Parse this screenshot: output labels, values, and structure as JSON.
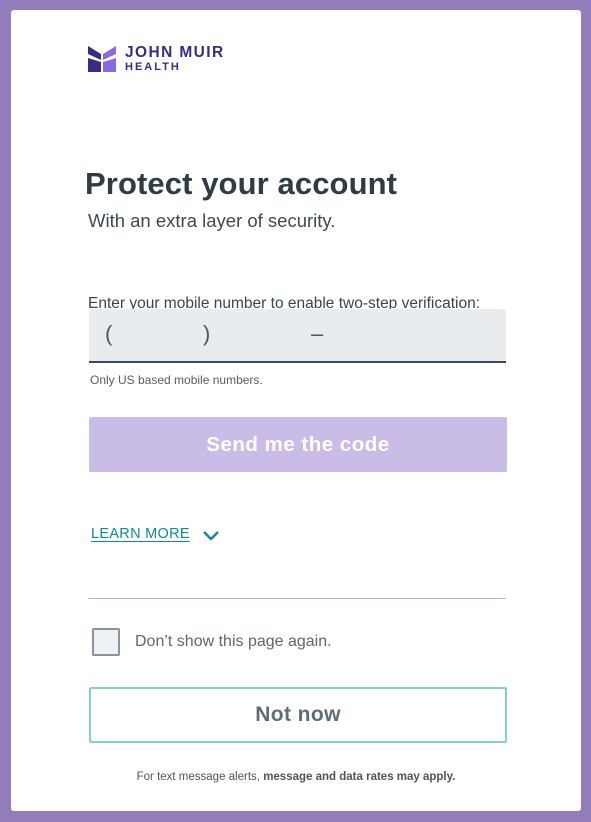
{
  "brand": {
    "name_line1": "JOHN MUIR",
    "name_line2": "HEALTH",
    "logo_color": "#7b5bd0",
    "logo_dark": "#3b2a84"
  },
  "heading": {
    "title": "Protect your account",
    "subtitle": "With an extra layer of security."
  },
  "phone": {
    "label": "Enter your mobile number to enable two-step verification:",
    "open_paren": "(",
    "close_paren": ")",
    "dash": "–",
    "helper": "Only US based mobile numbers."
  },
  "actions": {
    "send_code_label": "Send me the code",
    "learn_more_label": "LEARN MORE",
    "dont_show_label": "Don’t show this page again.",
    "not_now_label": "Not now"
  },
  "footer": {
    "prefix": "For text message alerts,",
    "bold": "message and data rates may apply."
  },
  "colors": {
    "background": "#937ebb",
    "send_button_disabled": "#c9bce6",
    "link_teal": "#0e8a93",
    "not_now_border": "#86cfd6"
  },
  "icons": {
    "logo": "butterfly-logo-icon",
    "learn_more": "chevron-down-icon"
  }
}
